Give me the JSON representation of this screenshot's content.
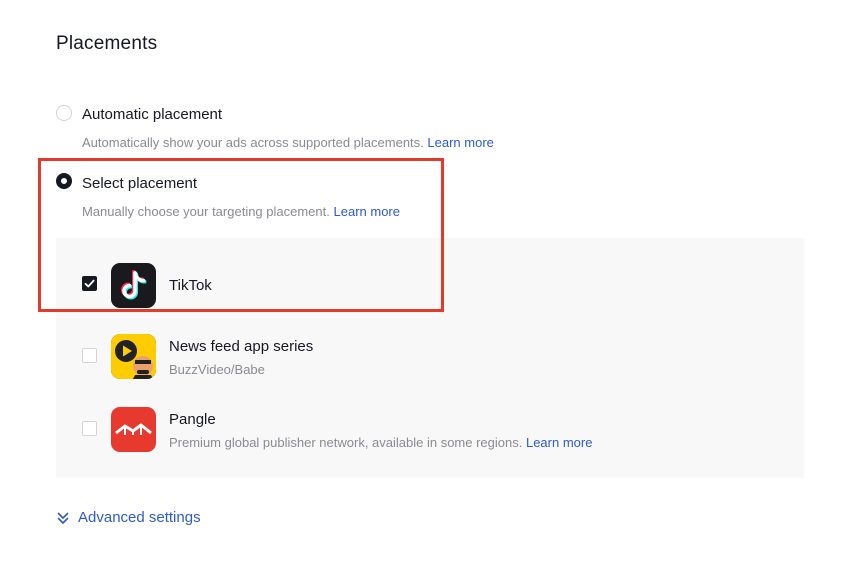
{
  "section": {
    "title": "Placements"
  },
  "placement_mode": {
    "automatic": {
      "label": "Automatic placement",
      "description": "Automatically show your ads across supported placements.",
      "link": "Learn more",
      "selected": false
    },
    "select": {
      "label": "Select placement",
      "description": "Manually choose your targeting placement.",
      "link": "Learn more",
      "selected": true
    }
  },
  "apps": [
    {
      "name": "TikTok",
      "subtitle": "",
      "checked": true,
      "icon": "tiktok-icon"
    },
    {
      "name": "News feed app series",
      "subtitle": "BuzzVideo/Babe",
      "checked": false,
      "icon": "buzzvideo-icon"
    },
    {
      "name": "Pangle",
      "subtitle": "Premium global publisher network, available in some regions.",
      "link": "Learn more",
      "checked": false,
      "icon": "pangle-icon"
    }
  ],
  "advanced": {
    "label": "Advanced settings",
    "icon": "double-chevron-down-icon"
  },
  "colors": {
    "accent_link": "#2e5bce",
    "highlight": "#e23a2b",
    "text": "#161823",
    "muted": "#8a8b91"
  }
}
